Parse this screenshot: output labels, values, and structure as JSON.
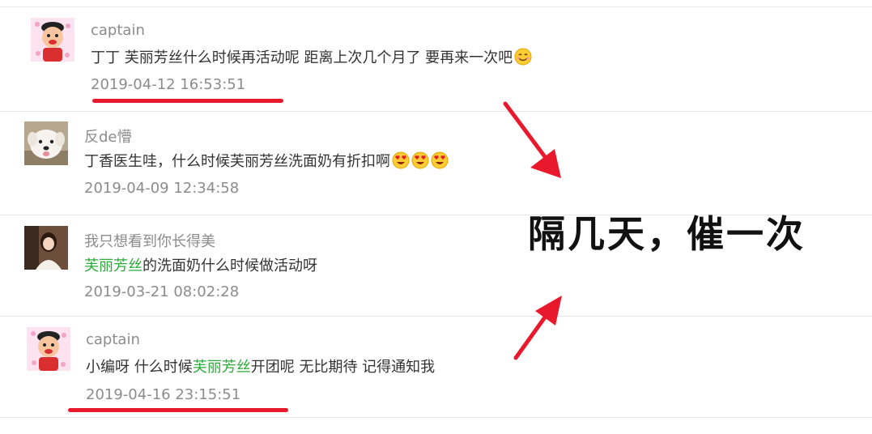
{
  "comments": [
    {
      "username": "captain",
      "avatar_icon": "cartoon-boy-avatar-icon",
      "text_parts": [
        "丁丁 芙丽芳丝什么时候再活动呢 距离上次几个月了 要再来一次吧"
      ],
      "emoji": "smiling-face-icon",
      "timestamp": "2019-04-12 16:53:51"
    },
    {
      "username": "反de懵",
      "avatar_icon": "white-dog-avatar-icon",
      "text_parts": [
        "丁香医生哇，什么时候芙丽芳丝洗面奶有折扣啊"
      ],
      "emoji": "heart-eyes-face-icon",
      "timestamp": "2019-04-09 12:34:58"
    },
    {
      "username": "我只想看到你长得美",
      "avatar_icon": "girl-photo-avatar-icon",
      "text_highlight": "芙丽芳丝",
      "text_after": "的洗面奶什么时候做活动呀",
      "timestamp": "2019-03-21 08:02:28"
    },
    {
      "username": "captain",
      "avatar_icon": "cartoon-boy-avatar-icon",
      "text_before": "小编呀 什么时候",
      "text_highlight": "芙丽芳丝",
      "text_after": "开团呢 无比期待 记得通知我",
      "timestamp": "2019-04-16 23:15:51"
    }
  ],
  "annotation": {
    "caption": "隔几天，催一次",
    "underline_color": "#e8192c",
    "arrow_color": "#e8192c"
  },
  "colors": {
    "highlight": "#2bab39",
    "meta": "#8c8c8c",
    "text": "#333333"
  }
}
